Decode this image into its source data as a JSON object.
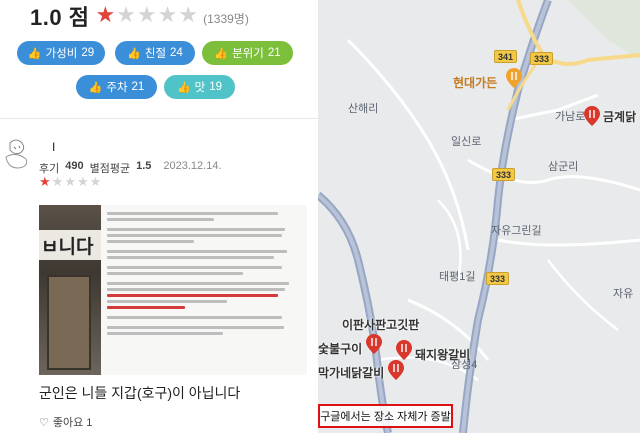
{
  "rating": {
    "score": "1.0 점",
    "count": "(1339명)",
    "stars_filled": 1,
    "stars_total": 5
  },
  "chips": [
    {
      "label": "가성비",
      "count": "29",
      "color": "#3b8fd9"
    },
    {
      "label": "친절",
      "count": "24",
      "color": "#3b8fd9"
    },
    {
      "label": "분위기",
      "count": "21",
      "color": "#7bbf3a"
    },
    {
      "label": "주차",
      "count": "21",
      "color": "#3b8fd9"
    },
    {
      "label": "맛",
      "count": "19",
      "color": "#4fc3c8"
    }
  ],
  "review": {
    "author": "I",
    "reviews_label": "후기",
    "reviews_count": "490",
    "avg_label": "별점평균",
    "avg_value": "1.5",
    "date": "2023.12.14.",
    "stars_filled": 1,
    "photo_sign_text": "ㅂ니다",
    "caption": "군인은 니들 지갑(호구)이 아닙니다",
    "like_label": "좋아요 1"
  },
  "map": {
    "labels": {
      "hyundai_garden": "현대가든",
      "geumge": "금계닭",
      "gaenamro": "가남로",
      "sanhaeri": "산해리",
      "ilsinro": "일신로",
      "samgunri": "삼군리",
      "jayugeurinro": "자유그린길",
      "jayu": "자유",
      "taemyeong": "태평1길",
      "ipansa": "이판사판고깃판",
      "bulgui": "숯불구이",
      "dwaeji": "돼지왕갈비",
      "dakgalbi": "막가네닭갈비",
      "samseong": "삼성4"
    },
    "shields": [
      "341",
      "333",
      "333",
      "333"
    ],
    "footer": "구글에서는 장소 자체가 증발"
  },
  "colors": {
    "accent_red": "#e0443a",
    "chip_blue": "#3b8fd9",
    "chip_green": "#7bbf3a",
    "chip_teal": "#4fc3c8",
    "road_blue": "#97a6c4",
    "highlight_red": "#d11"
  }
}
